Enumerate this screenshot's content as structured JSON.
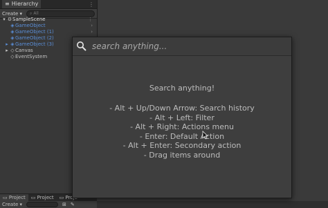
{
  "hierarchy": {
    "tab_label": "Hierarchy",
    "create_label": "Create",
    "search_placeholder": "All",
    "tree": [
      {
        "label": "SampleScene",
        "type": "scene",
        "indent": 0
      },
      {
        "label": "GameObject",
        "type": "gameobject",
        "indent": 1
      },
      {
        "label": "GameObject (1)",
        "type": "gameobject",
        "indent": 1
      },
      {
        "label": "GameObject (2)",
        "type": "gameobject",
        "indent": 1
      },
      {
        "label": "GameObject (3)",
        "type": "gameobject",
        "indent": 1
      },
      {
        "label": "Canvas",
        "type": "object",
        "indent": 1
      },
      {
        "label": "EventSystem",
        "type": "object",
        "indent": 1
      }
    ]
  },
  "project": {
    "tabs": [
      "Project",
      "Project",
      "Proje"
    ],
    "create_label": "Create"
  },
  "search": {
    "placeholder": "search anything...",
    "help_title": "Search anything!",
    "help_lines": [
      "- Alt + Up/Down Arrow: Search history",
      "- Alt + Left: Filter",
      "- Alt + Right: Actions menu",
      "- Enter: Default Action",
      "- Alt + Enter: Secondary action",
      "- Drag items around"
    ]
  },
  "colors": {
    "accent_blue": "#5b8fd9",
    "panel_bg": "#383838",
    "popup_bg": "#3e3e3e"
  }
}
